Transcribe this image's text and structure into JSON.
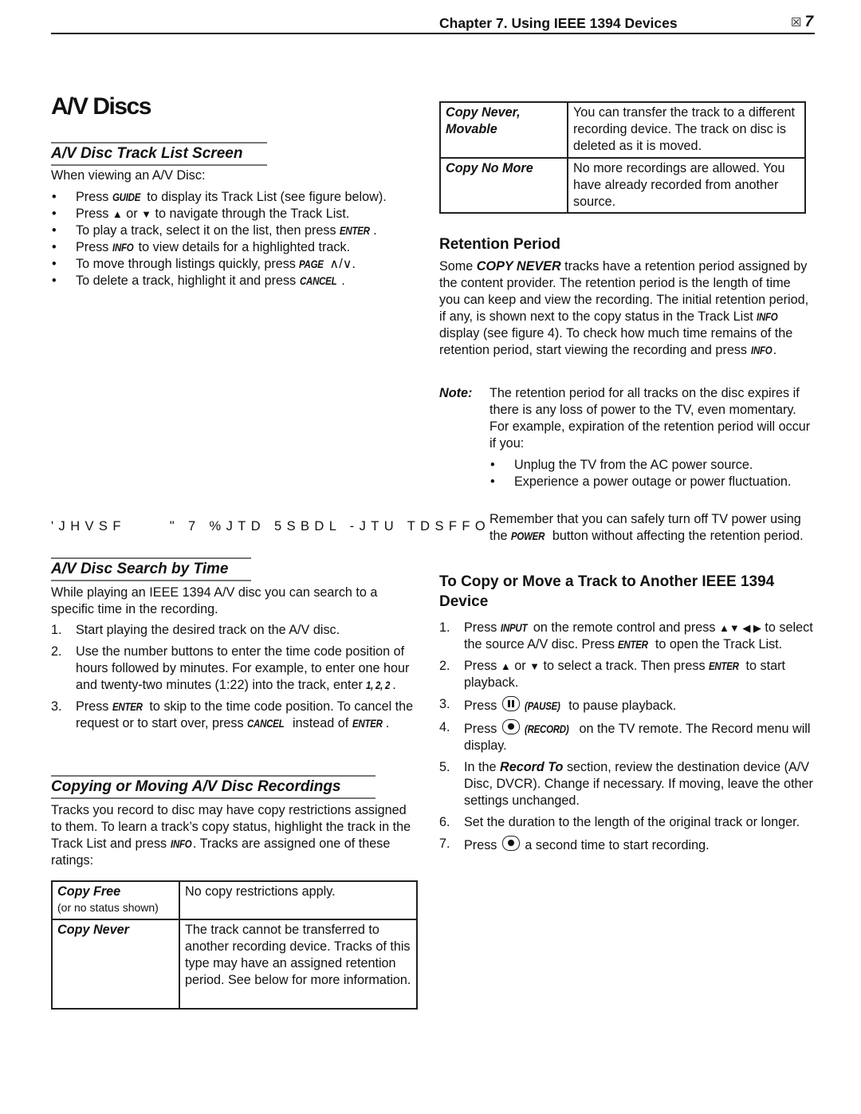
{
  "header": {
    "chapter_title": "Chapter 7.  Using IEEE 1394 Devices",
    "page_box_glyph": "☒",
    "page_number": "7"
  },
  "page_title": "A/V Discs",
  "track_list_section": {
    "heading": "A/V Disc Track List Screen",
    "intro": "When viewing an A/V Disc:",
    "bullets": [
      {
        "pre": "Press ",
        "key": "GUIDE",
        "post": " to display its Track List (see figure below)."
      },
      {
        "pre": "Press ",
        "up_arrow": "▲",
        "mid": " or ",
        "down_arrow": "▼",
        "post": " to navigate through the Track List."
      },
      {
        "pre": "To play a track, select it on the list, then press ",
        "key": "ENTER",
        "post": "."
      },
      {
        "pre": "Press ",
        "key": "INFO",
        "post": " to view details for a highlighted track."
      },
      {
        "pre": "To move through listings quickly, press ",
        "key": "PAGE",
        "symbols": "∧/∨",
        "post": "."
      },
      {
        "pre": "To delete a track, highlight it and press ",
        "key": "CANCEL",
        "post": "."
      }
    ]
  },
  "figure_caption": "'JHVSF     \" 7 %JTD 5SBDL -JTU TDSFFO",
  "search_section": {
    "heading": "A/V Disc Search by Time",
    "intro": "While playing an IEEE 1394 A/V disc you can search to a specific time in the recording.",
    "steps": [
      {
        "num": "1.",
        "text": "Start playing the desired track on the A/V disc."
      },
      {
        "num": "2.",
        "text": "Use the number buttons to enter the time code position of hours followed by minutes.  For example, to enter one hour and twenty-two minutes (1:22) into the track, enter ",
        "keys": "1, 2, 2",
        "post": "."
      },
      {
        "num": "3.",
        "pre": "Press ",
        "key1": "ENTER",
        "mid": " to skip to the time code position.  To cancel the request or to start over, press ",
        "key2": "CANCEL",
        "mid2": " instead of ",
        "key3": "ENTER",
        "post": "."
      }
    ]
  },
  "copying_section": {
    "heading": "Copying or Moving A/V Disc Recordings",
    "intro_pre": "Tracks you record to disc may have copy restrictions assigned to them.  To learn a track’s copy status, highlight the track in the Track List and press ",
    "intro_key": "INFO",
    "intro_post": ".  Tracks are assigned one of these ratings:",
    "ratings_left": [
      {
        "name": "Copy Free",
        "sub": "(or no status shown)",
        "description": "No copy restrictions apply."
      },
      {
        "name": "Copy Never",
        "sub": "",
        "description": "The track cannot be transferred to another recording device.  Tracks of this type may have an assigned retention period.  See below for more information."
      }
    ],
    "ratings_right": [
      {
        "name": "Copy Never, Movable",
        "description": "You can transfer the track to a different recording device.  The track on disc is deleted as it is moved."
      },
      {
        "name": "Copy No More",
        "description": "No more recordings are allowed. You have already recorded from another source."
      }
    ]
  },
  "retention_section": {
    "heading": "Retention Period",
    "para_pre": "Some ",
    "para_bold": "COPY NEVER",
    "para_mid": " tracks have a retention period assigned by the content provider.  The retention period is the length of time you can keep and view the recording.  The initial retention period, if any, is shown next to the copy status in the Track List ",
    "para_key1": "INFO",
    "para_mid2": " display (see figure 4). To check how much time remains of the retention period, start viewing the recording and press ",
    "para_key2": "INFO",
    "para_post": ".",
    "note_label": "Note:",
    "note_text": "The retention period for all tracks on the disc expires if there is any loss of power to the TV, even momentary.  For example, expiration of the retention period will occur if you:",
    "note_bullets": [
      "Unplug the TV from the AC power source.",
      "Experience a power outage or power fluctuation."
    ],
    "remember_pre": "Remember that you can safely turn off TV power using the ",
    "remember_key": "POWER",
    "remember_post": " button without affecting the retention period."
  },
  "copy_move_section": {
    "heading": "To Copy or Move a Track to Another IEEE 1394 Device",
    "steps": [
      {
        "num": "1.",
        "pre": "Press ",
        "key1": "INPUT",
        "mid": " on the remote control and  press ",
        "arrows": "▲▼ ◀ ▶",
        "mid2": " to select the source A/V disc.  Press ",
        "key2": "ENTER",
        "post": " to open the Track List."
      },
      {
        "num": "2.",
        "pre": "Press ",
        "up_arrow": "▲",
        "mid": " or ",
        "down_arrow": "▼",
        "mid2": " to select a track.  Then press ",
        "key": "ENTER",
        "post": " to start playback."
      },
      {
        "num": "3.",
        "pre": "Press ",
        "key": "(PAUSE)",
        "post": " to pause playback."
      },
      {
        "num": "4.",
        "pre": "Press ",
        "key": "(RECORD)",
        "post": " on the TV remote.  The Record menu will display."
      },
      {
        "num": "5.",
        "pre": "In the ",
        "bold": "Record To",
        "post": " section, review the destination device (A/V Disc, DVCR).  Change if necessary.  If moving, leave the other settings unchanged."
      },
      {
        "num": "6.",
        "text": "Set the duration to the length of the original track or longer."
      },
      {
        "num": "7.",
        "pre": "Press ",
        "post": " a second time to start recording."
      }
    ]
  }
}
